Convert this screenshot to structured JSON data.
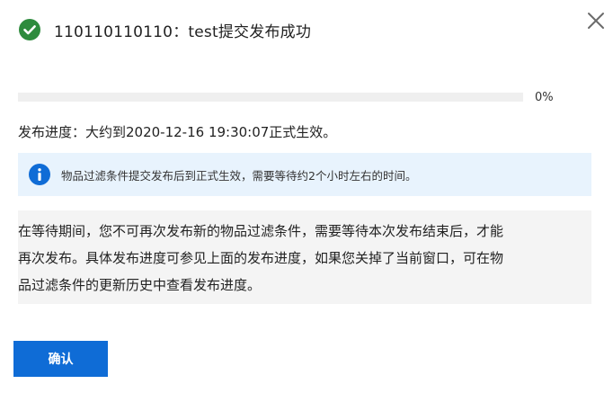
{
  "header": {
    "title": "110110110110：test提交发布成功",
    "icon": "check-circle-icon",
    "icon_color": "#2e8b3d"
  },
  "close": {
    "icon": "close-icon",
    "label": "×"
  },
  "progress": {
    "value": 0,
    "percent_label": "0%",
    "fill_color": "#0078d4"
  },
  "publish_progress_text": "发布进度：大约到2020-12-16 19:30:07正式生效。",
  "info_bar": {
    "icon": "info-icon",
    "text": "物品过滤条件提交发布后到正式生效，需要等待约2个小时左右的时间。",
    "icon_color": "#0f6cd6"
  },
  "notice": {
    "lines": [
      "在等待期间，您不可再次发布新的物品过滤条件，需要等待本次发布结束后，才能",
      "再次发布。具体发布进度可参见上面的发布进度，如果您关掉了当前窗口，可在物",
      "品过滤条件的更新历史中查看发布进度。"
    ]
  },
  "footer": {
    "confirm_label": "确认",
    "button_color": "#0f6cd6"
  }
}
